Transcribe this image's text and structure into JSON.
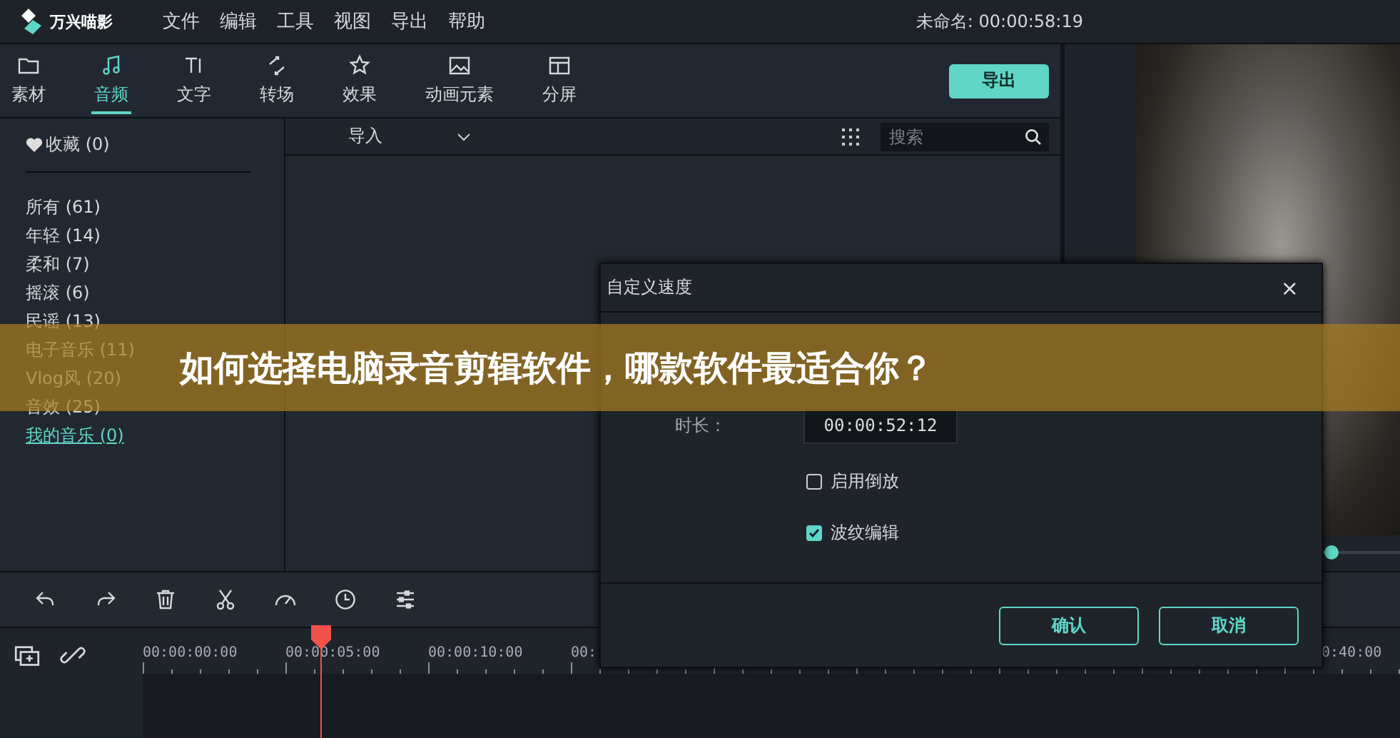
{
  "app": {
    "name": "万兴喵影"
  },
  "menu": [
    "文件",
    "编辑",
    "工具",
    "视图",
    "导出",
    "帮助"
  ],
  "project_time": "未命名: 00:00:58:19",
  "tabs": [
    {
      "label": "素材",
      "selected": false
    },
    {
      "label": "音频",
      "selected": true
    },
    {
      "label": "文字",
      "selected": false
    },
    {
      "label": "转场",
      "selected": false
    },
    {
      "label": "效果",
      "selected": false
    },
    {
      "label": "动画元素",
      "selected": false
    },
    {
      "label": "分屏",
      "selected": false
    }
  ],
  "export_button": "导出",
  "sidebar": {
    "favorites": "收藏 (0)",
    "items": [
      {
        "label": "所有 (61)",
        "kind": "category"
      },
      {
        "label": "年轻 (14)",
        "kind": "category"
      },
      {
        "label": "柔和 (7)",
        "kind": "category"
      },
      {
        "label": "摇滚 (6)",
        "kind": "category"
      },
      {
        "label": "民谣 (13)",
        "kind": "category"
      },
      {
        "label": "电子音乐 (11)",
        "kind": "category"
      },
      {
        "label": "Vlog风 (20)",
        "kind": "category"
      },
      {
        "label": "音效 (25)",
        "kind": "category"
      },
      {
        "label": "我的音乐 (0)",
        "kind": "link"
      }
    ]
  },
  "library": {
    "import": "导入",
    "search": {
      "placeholder": "搜索"
    }
  },
  "preview": {
    "level": 0.74
  },
  "timeline": {
    "ruler": [
      "00:00:00:00",
      "00:00:05:00",
      "00:00:10:00",
      "00:"
    ],
    "ruler_end": "0:40:00"
  },
  "dialog": {
    "title": "自定义速度",
    "close": "×",
    "duration_label": "时长：",
    "duration": "00:00:52:12",
    "options": [
      {
        "label": "启用倒放",
        "checked": false
      },
      {
        "label": "波纹编辑",
        "checked": true
      }
    ],
    "buttons": [
      "确认",
      "取消"
    ]
  },
  "banner": "如何选择电脑录音剪辑软件，哪款软件最适合你？"
}
